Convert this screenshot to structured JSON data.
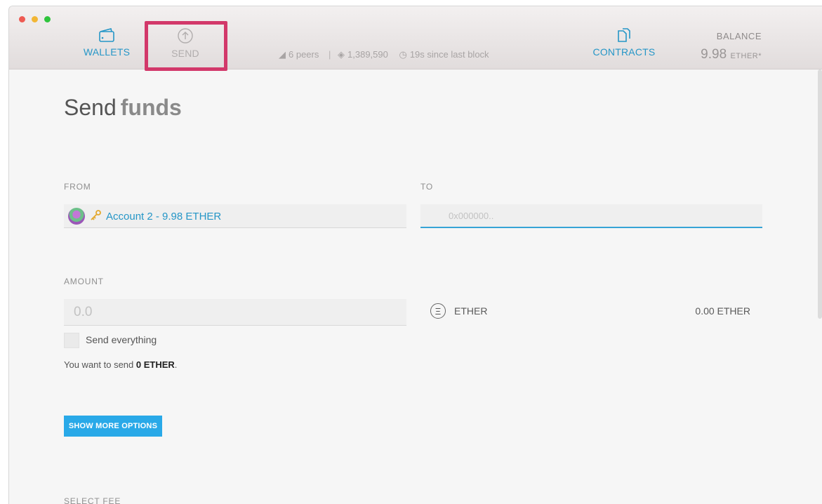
{
  "header": {
    "nav": {
      "wallets": "WALLETS",
      "send": "SEND",
      "contracts": "CONTRACTS"
    },
    "status": {
      "peers": "6 peers",
      "separator": "|",
      "block": "1,389,590",
      "since_block": "19s since last block"
    },
    "balance": {
      "title": "BALANCE",
      "value": "9.98",
      "unit": "ETHER*"
    }
  },
  "main": {
    "title_bold": "Send",
    "title_light": "funds",
    "from": {
      "label": "FROM",
      "account": "Account 2 - 9.98 ETHER"
    },
    "to": {
      "label": "TO",
      "placeholder": "0x000000.."
    },
    "amount": {
      "label": "AMOUNT",
      "placeholder": "0.0",
      "currency": "ETHER",
      "currency_symbol": "Ξ",
      "total": "0.00 ETHER"
    },
    "send_everything": "Send everything",
    "want_prefix": "You want to send",
    "want_value": "0 ETHER",
    "want_suffix": ".",
    "more_options": "SHOW MORE OPTIONS",
    "select_fee": "SELECT FEE"
  },
  "colors": {
    "accent": "#2596c7",
    "highlight": "#d2386a",
    "button": "#29a9e8"
  },
  "icons": [
    "wallet-icon",
    "send-arrow-icon",
    "contracts-icon",
    "peers-icon",
    "block-icon",
    "clock-icon",
    "key-icon",
    "ether-icon"
  ]
}
